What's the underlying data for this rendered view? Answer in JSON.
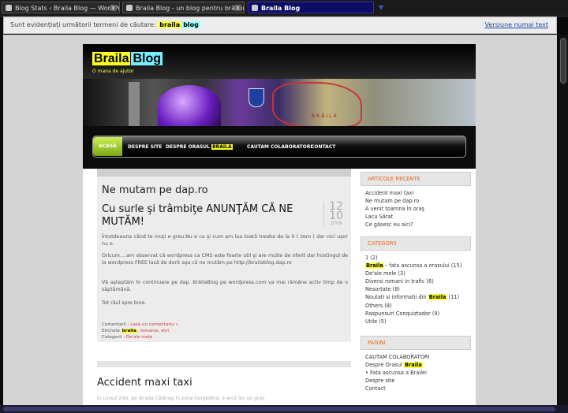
{
  "browser": {
    "tabs": [
      {
        "label": "Blog Stats ‹ Braila Blog — WordPress",
        "active": false
      },
      {
        "label": "Braila Blog - un blog pentru brăileni",
        "active": false
      },
      {
        "label": "Braila Blog",
        "active": true
      }
    ],
    "close_glyph": "x",
    "tab_list_glyph": "▼"
  },
  "search_highlight": {
    "prefix": "Sunt evidențiați următorii termeni de căutare:",
    "term1": "braila",
    "term2": "blog",
    "cached_link": "Versiune numai text"
  },
  "site": {
    "logo_part1": "Braila",
    "logo_part2": "Blog",
    "tagline": "O mana de ajutor",
    "banner_label": "BRĂILA"
  },
  "nav": {
    "items": [
      "ACASĂ",
      "DESPRE SITE",
      "DESPRE ORASUL",
      "CAUTAM COLABORATORI",
      "CONTACT"
    ],
    "highlight_word": "BRAILA",
    "active_index": 0
  },
  "post": {
    "page_title": "Ne mutam pe dap.ro",
    "title": "Cu surle şi trâmbiţe ANUNŢĂM CĂ NE MUTĂM!",
    "date_day": "12",
    "date_month": "10",
    "date_year": "2009",
    "paragraphs": [
      "Întotdeauna când te muţi e greu.Nu e ca şi cum am lua toată treaba de la 0 ( zero ) dar nici uşor nu e.",
      "Oricum….am observat că wordpress ca CMS este foarte util şi are multe de oferit dar hostingul de la wordpress FREE lasă de dorit aşa că ne mutăm pe http://brailablog.dap.ro",
      "Vă aşteptăm în continuare pe dap. BrăilaBlog pe wordpress.com va mai rămâne activ timp de o săptămână.",
      "Tot răul spre bine."
    ],
    "meta": {
      "comments_label": "Comentarii :",
      "comments_link": "Lasă un comentariu »",
      "tags_label": "Etichete",
      "tag_highlight": "braila",
      "tags_rest": ", romania, stiri",
      "categories_label": "Categorii :",
      "category": "De'ale mele"
    }
  },
  "next_post": {
    "title": "Accident maxi taxi",
    "excerpt": "În cursul zilei, pe strada Călăraşi în zona Gorgodina, a avut loc un grav"
  },
  "sidebar": {
    "recent_title": "ARTICOLE RECENTE",
    "recent": [
      "Accident maxi taxi",
      "Ne mutam pe dap.ro",
      "A venit toamna în oraş",
      "Lacu Sărat",
      "Ce găsesc eu aici?"
    ],
    "categories_title": "CATEGORII",
    "categories": [
      {
        "pre": "",
        "hl": "",
        "post": "1 (2)"
      },
      {
        "pre": "",
        "hl": "Braila",
        "post": " - fata ascunsa a orasului (15)"
      },
      {
        "pre": "De'ale mele (3)",
        "hl": "",
        "post": ""
      },
      {
        "pre": "Diversi romani in trafic (6)",
        "hl": "",
        "post": ""
      },
      {
        "pre": "Nesortate (8)",
        "hl": "",
        "post": ""
      },
      {
        "pre": "Noutati si informatii din ",
        "hl": "Braila",
        "post": " (11)"
      },
      {
        "pre": "Others (8)",
        "hl": "",
        "post": ""
      },
      {
        "pre": "Raspunsuri Conquiztador (9)",
        "hl": "",
        "post": ""
      },
      {
        "pre": "Utile (5)",
        "hl": "",
        "post": ""
      }
    ],
    "pages_title": "PAGINI",
    "pages": [
      {
        "pre": "CAUTAM COLABORATORI",
        "hl": "",
        "post": ""
      },
      {
        "pre": "Despre Orasul ",
        "hl": "Braila",
        "post": ""
      },
      {
        "pre": "   • Fata ascunsa a Brailei",
        "hl": "",
        "post": ""
      },
      {
        "pre": "Despre site",
        "hl": "",
        "post": ""
      },
      {
        "pre": "Contact",
        "hl": "",
        "post": ""
      }
    ]
  }
}
